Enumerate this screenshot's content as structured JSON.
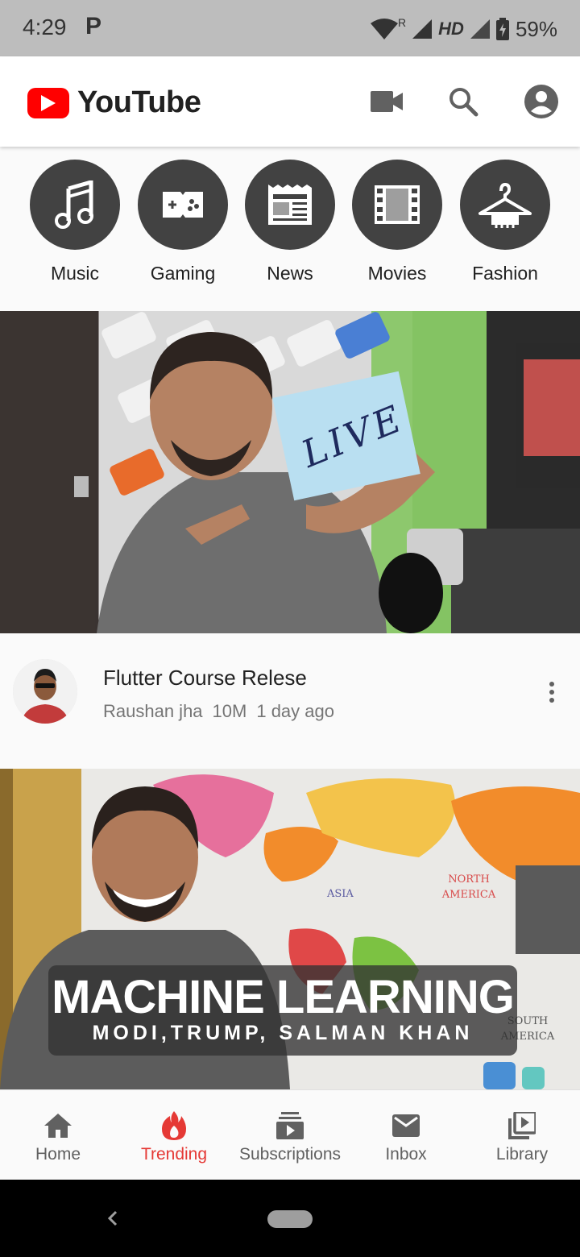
{
  "status_bar": {
    "time": "4:29",
    "notification_app": "P",
    "network": "HD",
    "roaming": "R",
    "battery": "59%"
  },
  "header": {
    "app_name": "YouTube",
    "icons": [
      "video-camera-icon",
      "search-icon",
      "account-icon"
    ]
  },
  "categories": [
    {
      "label": "Music",
      "icon": "music-note-icon"
    },
    {
      "label": "Gaming",
      "icon": "gamepad-icon"
    },
    {
      "label": "News",
      "icon": "newspaper-icon"
    },
    {
      "label": "Movies",
      "icon": "film-icon"
    },
    {
      "label": "Fashion",
      "icon": "hanger-icon"
    }
  ],
  "videos": [
    {
      "thumbnail_text": "LIVE",
      "title": "Flutter Course Relese",
      "channel": "Raushan jha",
      "views": "10M",
      "age": "1 day ago"
    },
    {
      "thumbnail_title": "MACHINE LEARNING",
      "thumbnail_subtitle": "MODI,TRUMP, SALMAN KHAN",
      "map_labels": [
        "ASIA",
        "NORTH AMERICA",
        "SOUTH AMERICA"
      ]
    }
  ],
  "bottom_nav": [
    {
      "label": "Home",
      "icon": "home-icon"
    },
    {
      "label": "Trending",
      "icon": "flame-icon",
      "active": true
    },
    {
      "label": "Subscriptions",
      "icon": "subscriptions-icon"
    },
    {
      "label": "Inbox",
      "icon": "mail-icon"
    },
    {
      "label": "Library",
      "icon": "library-icon"
    }
  ],
  "colors": {
    "brand_red": "#ff0000",
    "active_tab": "#e53935",
    "category_circle": "#424242",
    "status_bar": "#bdbdbd"
  }
}
